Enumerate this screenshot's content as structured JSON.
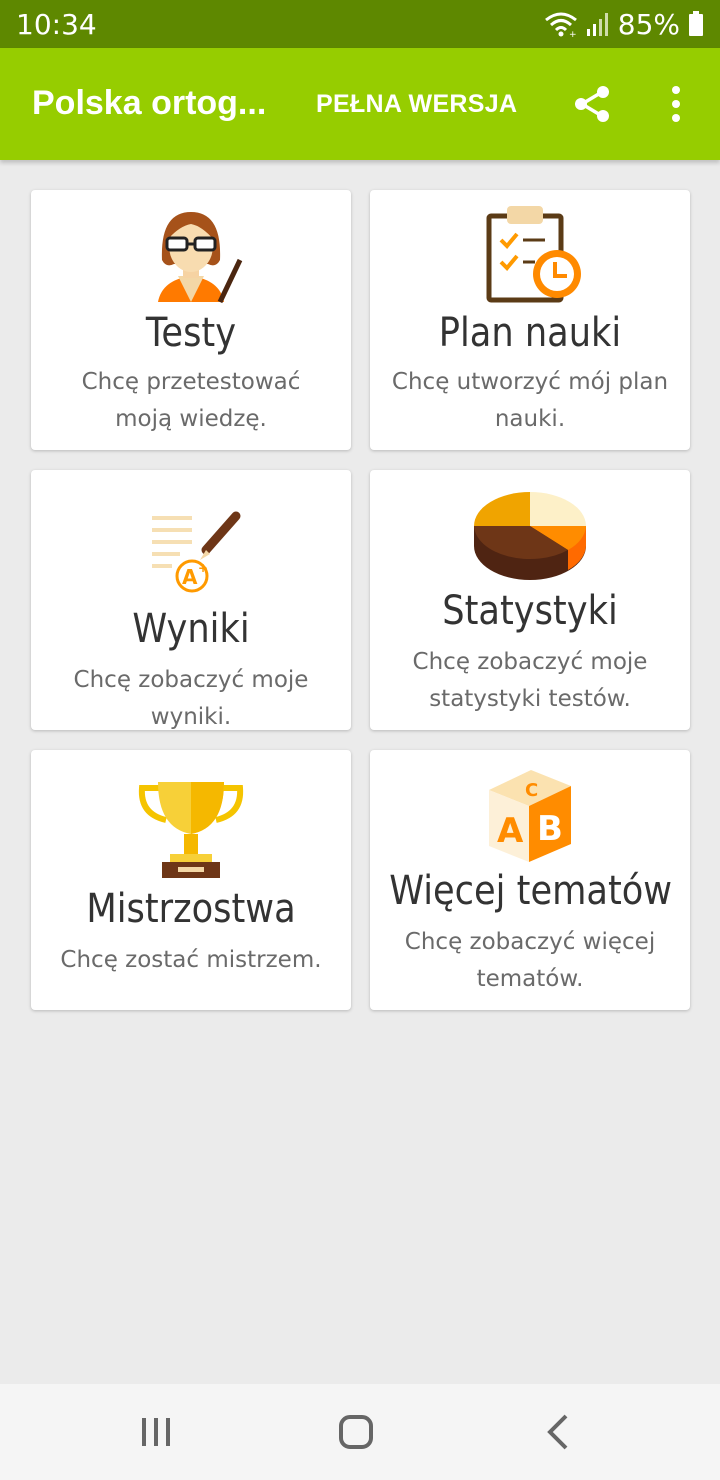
{
  "status_bar": {
    "time": "10:34",
    "battery": "85%"
  },
  "app_bar": {
    "title": "Polska ortog...",
    "full_version_label": "PEŁNA WERSJA",
    "share_icon": "share-icon",
    "more_icon": "more-vert-icon"
  },
  "cards": [
    {
      "title": "Testy",
      "description": "Chcę przetestować moją wiedzę.",
      "icon": "teacher-icon"
    },
    {
      "title": "Plan nauki",
      "description": "Chcę utworzyć mój plan nauki.",
      "icon": "clipboard-clock-icon"
    },
    {
      "title": "Wyniki",
      "description": "Chcę zobaczyć moje wyniki.",
      "icon": "graded-paper-icon"
    },
    {
      "title": "Statystyki",
      "description": "Chcę zobaczyć moje statystyki testów.",
      "icon": "pie-chart-icon"
    },
    {
      "title": "Mistrzostwa",
      "description": "Chcę zostać mistrzem.",
      "icon": "trophy-icon"
    },
    {
      "title": "Więcej tematów",
      "description": "Chcę zobaczyć więcej tematów.",
      "icon": "abc-block-icon"
    }
  ],
  "colors": {
    "status_bar": "#5e8800",
    "app_bar": "#96cd00",
    "background": "#ebebeb"
  }
}
